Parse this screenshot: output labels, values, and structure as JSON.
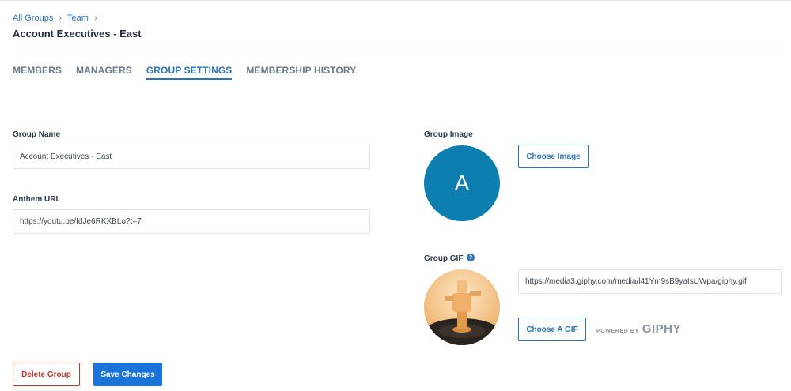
{
  "breadcrumb": {
    "items": [
      "All Groups",
      "Team"
    ],
    "separator": "›"
  },
  "page_title": "Account Executives - East",
  "tabs": [
    {
      "label": "MEMBERS",
      "active": false
    },
    {
      "label": "MANAGERS",
      "active": false
    },
    {
      "label": "GROUP SETTINGS",
      "active": true
    },
    {
      "label": "MEMBERSHIP HISTORY",
      "active": false
    }
  ],
  "form": {
    "group_name_label": "Group Name",
    "group_name_value": "Account Executives - East",
    "anthem_url_label": "Anthem URL",
    "anthem_url_value": "https://youtu.be/IdJe6RKXBLo?t=7",
    "group_image_label": "Group Image",
    "avatar_letter": "A",
    "choose_image_label": "Choose Image",
    "group_gif_label": "Group GIF",
    "help_icon_glyph": "?",
    "gif_url_value": "https://media3.giphy.com/media/l41Ym9sB9yaIsUWpa/giphy.gif",
    "choose_gif_label": "Choose A GIF",
    "powered_by": "POWERED BY",
    "giphy_brand": "GIPHY"
  },
  "actions": {
    "delete_label": "Delete Group",
    "save_label": "Save Changes"
  },
  "colors": {
    "accent": "#2d73b8",
    "primary_button": "#1a73d9",
    "danger": "#b23a30",
    "avatar_bg": "#0c7fb0"
  }
}
